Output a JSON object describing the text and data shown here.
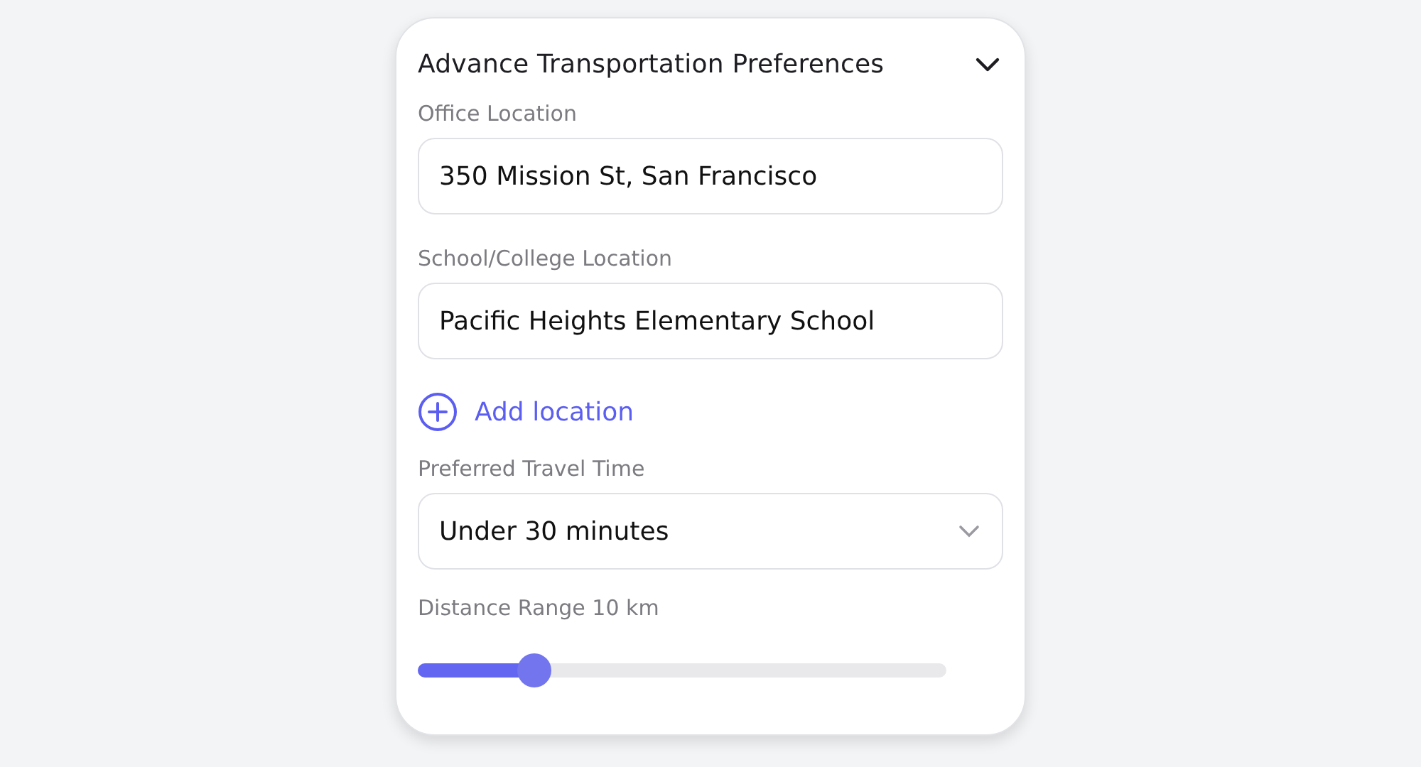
{
  "panel": {
    "title": "Advance Transportation Preferences",
    "expanded": true
  },
  "fields": [
    {
      "kind": "text",
      "label": "Office Location",
      "value": "350 Mission St, San Francisco"
    },
    {
      "kind": "text",
      "label": "School/College Location",
      "value": "Pacific Heights Elementary School"
    },
    {
      "kind": "add",
      "label": "Add location"
    },
    {
      "kind": "select",
      "label": "Preferred Travel Time",
      "value": "Under 30 minutes"
    },
    {
      "kind": "slider",
      "label": "Distance Range 10 km",
      "level": 0.22
    }
  ]
}
